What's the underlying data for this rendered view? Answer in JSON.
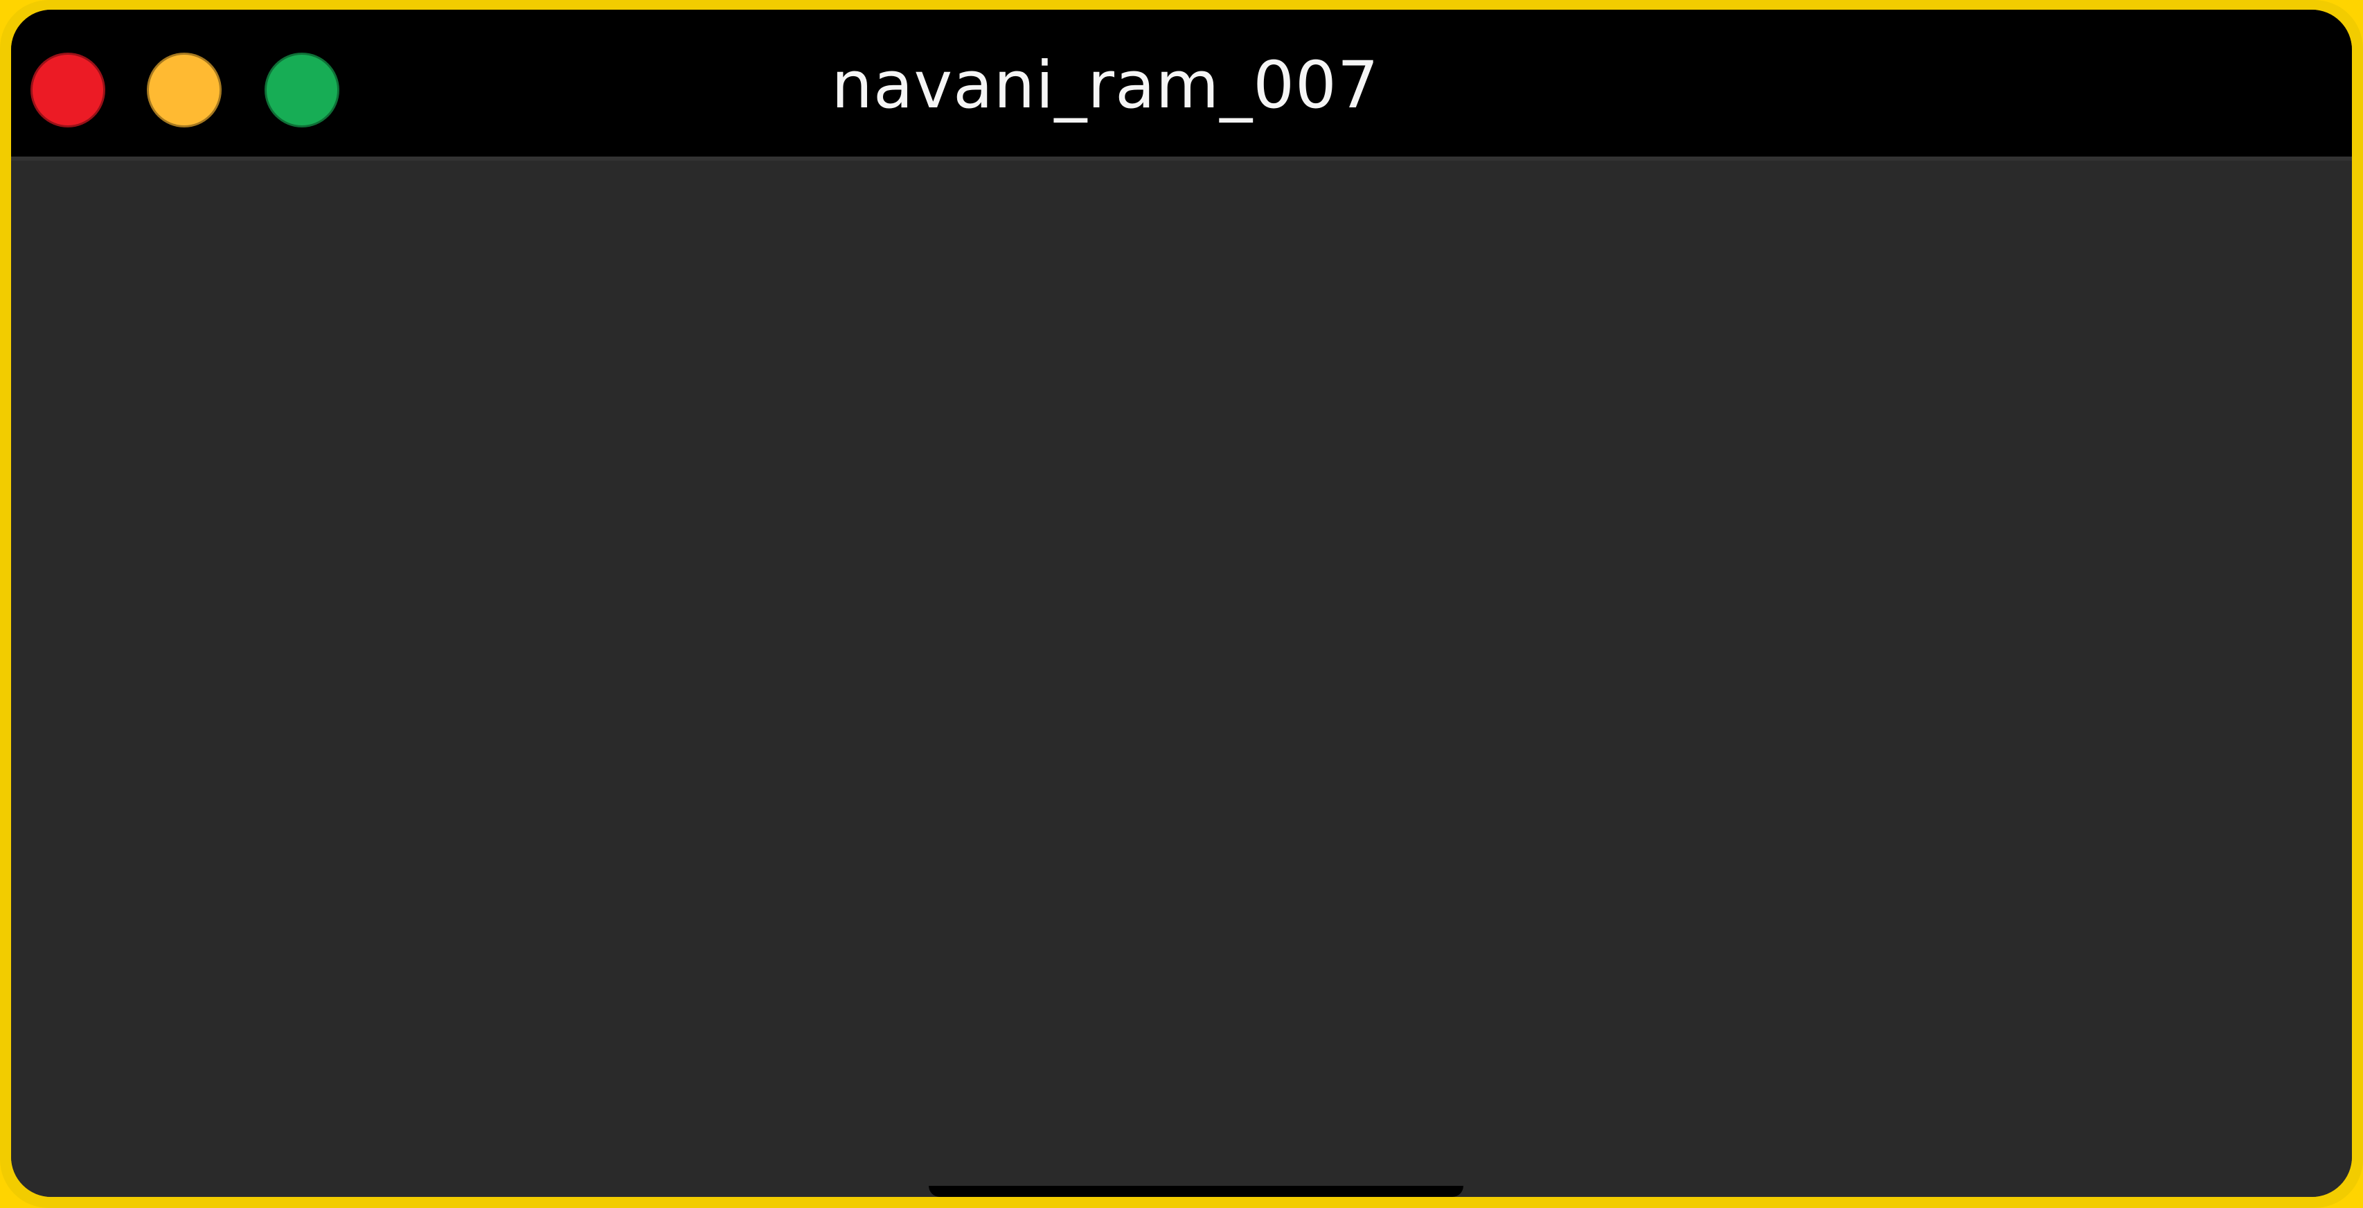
{
  "window": {
    "title": "navani_ram_007"
  },
  "controls": {
    "close_color": "#ec1b25",
    "minimize_color": "#ffba32",
    "maximize_color": "#17ad55"
  },
  "colors": {
    "frame": "#f2cc00",
    "title_bar": "#000000",
    "content": "#2a2a2a"
  }
}
